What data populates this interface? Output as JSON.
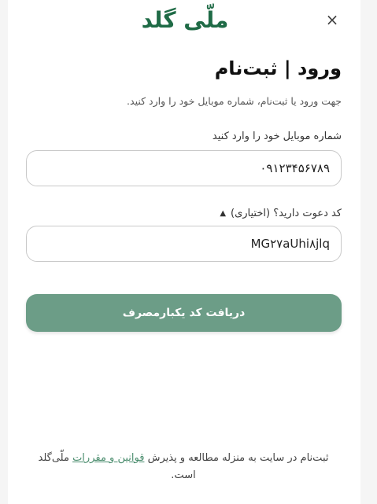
{
  "header": {
    "logo_text": "ملّی گلد",
    "close_glyph": "×"
  },
  "auth": {
    "title": "ورود | ثبت‌نام",
    "subtitle": "جهت ورود یا ثبت‌نام، شماره موبایل خود را وارد کنید."
  },
  "mobile": {
    "label": "شماره موبایل خود را وارد کنید",
    "value": "۰۹۱۲۳۴۵۶۷۸۹"
  },
  "invite": {
    "label": "کد دعوت دارید؟ (اختیاری)",
    "toggle_glyph": "▲",
    "value": "MG۲۷aUhi۸jlq"
  },
  "submit": {
    "label": "دریافت کد یکبارمصرف"
  },
  "terms": {
    "prefix": "ثبت‌نام در سایت به منزله مطالعه و پذیرش ",
    "link": "قوانین و مقررات",
    "suffix": " ملّی‌گلد است."
  },
  "colors": {
    "brand": "#1f6b46",
    "button": "#6c9d87",
    "link": "#4b8d6e"
  }
}
